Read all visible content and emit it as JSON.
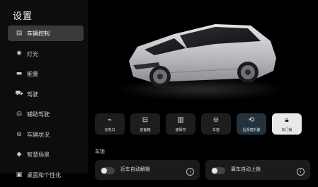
{
  "app": {
    "title": "设置"
  },
  "sidebar": {
    "items": [
      {
        "label": "车辆控制",
        "icon": "car-control-icon",
        "active": true
      },
      {
        "label": "灯光",
        "icon": "light-icon",
        "active": false
      },
      {
        "label": "能量",
        "icon": "battery-icon",
        "active": false
      },
      {
        "label": "驾驶",
        "icon": "car-icon",
        "active": false
      },
      {
        "label": "辅助驾驶",
        "icon": "steering-assist-icon",
        "active": false
      },
      {
        "label": "车辆状况",
        "icon": "vehicle-status-icon",
        "active": false
      },
      {
        "label": "智慧场景",
        "icon": "cube-icon",
        "active": false
      },
      {
        "label": "桌面和个性化",
        "icon": "desktop-icon",
        "active": false
      }
    ]
  },
  "controls": [
    {
      "label": "充电口",
      "icon": "charge-port-icon"
    },
    {
      "label": "前备箱",
      "icon": "front-trunk-icon"
    },
    {
      "label": "遮阳帘",
      "icon": "sunshade-icon"
    },
    {
      "label": "车窗",
      "icon": "window-icon"
    },
    {
      "label": "后视镜折叠",
      "icon": "mirror-fold-icon"
    },
    {
      "label": "车门锁",
      "icon": "lock-icon"
    }
  ],
  "section": {
    "label": "车锁"
  },
  "cards": [
    {
      "label": "近车自动解锁"
    },
    {
      "label": "离车自动上锁"
    }
  ],
  "colors": {
    "active_nav": "#3a3a3a",
    "mirror_active": "#22333f",
    "lock_active": "#e8e8e8",
    "car_body": "#c9cacd"
  }
}
